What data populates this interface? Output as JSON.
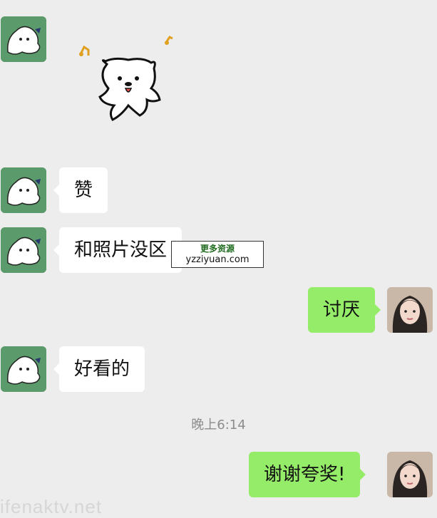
{
  "messages": [
    {
      "text": "赞"
    },
    {
      "text": "和照片没区"
    },
    {
      "text": "讨厌"
    },
    {
      "text": "好看的"
    },
    {
      "text": "谢谢夸奖!"
    }
  ],
  "timestamp": "晚上6:14",
  "watermark": {
    "line1": "更多资源",
    "line2": "yzziyuan.com"
  },
  "bottom_watermark": "ifenaktv.net",
  "colors": {
    "background": "#ededed",
    "incoming_bubble": "#ffffff",
    "outgoing_bubble": "#95ec69"
  }
}
